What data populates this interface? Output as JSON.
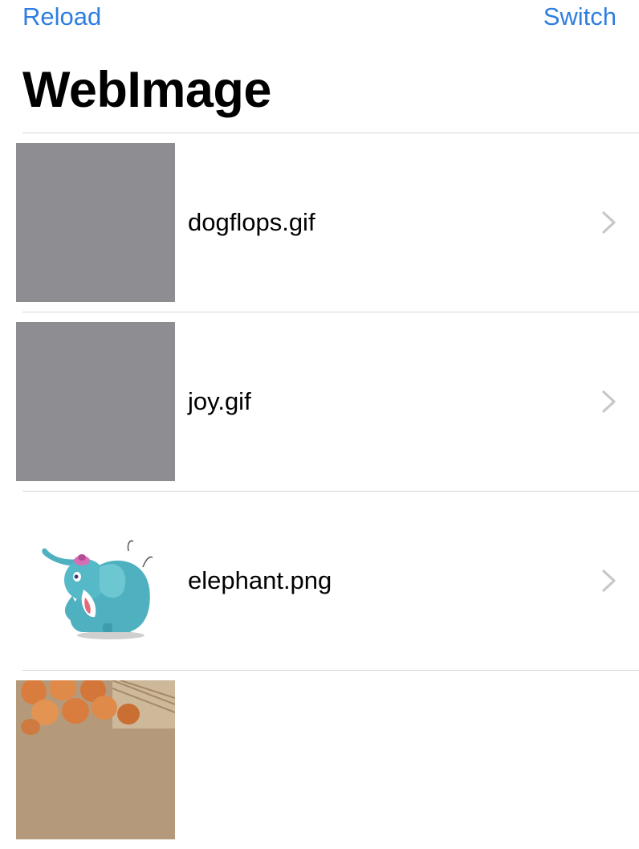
{
  "nav": {
    "left_button": "Reload",
    "right_button": "Switch",
    "title": "WebImage"
  },
  "colors": {
    "tint": "#2f7ee0",
    "placeholder": "#8e8d92",
    "separator": "#d6d6d8",
    "chevron": "#c7c7cc"
  },
  "images": [
    {
      "filename": "dogflops.gif",
      "thumbnail": "placeholder"
    },
    {
      "filename": "joy.gif",
      "thumbnail": "placeholder"
    },
    {
      "filename": "elephant.png",
      "thumbnail": "elephant-illustration"
    },
    {
      "filename": "",
      "thumbnail": "eggs-photo"
    }
  ]
}
